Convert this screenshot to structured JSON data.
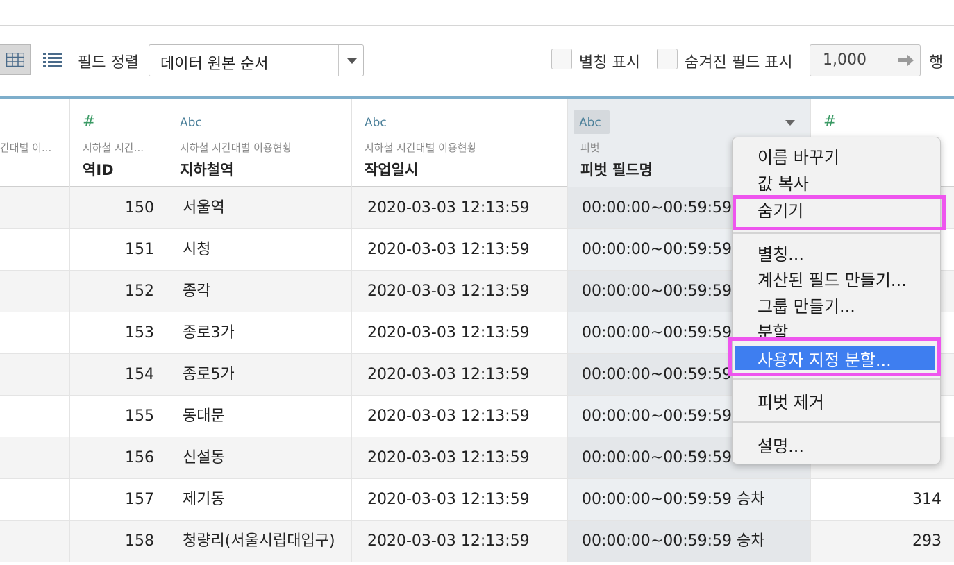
{
  "toolbar": {
    "sort_label": "필드 정렬",
    "sort_value": "데이터 원본 순서",
    "alias_label": "별칭 표시",
    "hidden_fields_label": "숨겨진 필드 표시",
    "row_count": "1,000",
    "rows_unit": "행"
  },
  "columns": [
    {
      "type": "",
      "source": "간대별 이...",
      "name": ""
    },
    {
      "type": "#",
      "source": "지하철 시간...",
      "name": "역ID"
    },
    {
      "type": "Abc",
      "source": "지하철 시간대별 이용현황",
      "name": "지하철역"
    },
    {
      "type": "Abc",
      "source": "지하철 시간대별 이용현황",
      "name": "작업일시"
    },
    {
      "type": "Abc",
      "source": "피벗",
      "name": "피벗 필드명"
    },
    {
      "type": "#",
      "source": "",
      "name": ""
    }
  ],
  "rows": [
    {
      "id": "150",
      "station": "서울역",
      "datetime": "2020-03-03 12:13:59",
      "pivot": "00:00:00~00:59:59",
      "value": ""
    },
    {
      "id": "151",
      "station": "시청",
      "datetime": "2020-03-03 12:13:59",
      "pivot": "00:00:00~00:59:59",
      "value": ""
    },
    {
      "id": "152",
      "station": "종각",
      "datetime": "2020-03-03 12:13:59",
      "pivot": "00:00:00~00:59:59",
      "value": ""
    },
    {
      "id": "153",
      "station": "종로3가",
      "datetime": "2020-03-03 12:13:59",
      "pivot": "00:00:00~00:59:59",
      "value": ""
    },
    {
      "id": "154",
      "station": "종로5가",
      "datetime": "2020-03-03 12:13:59",
      "pivot": "00:00:00~00:59:59",
      "value": ""
    },
    {
      "id": "155",
      "station": "동대문",
      "datetime": "2020-03-03 12:13:59",
      "pivot": "00:00:00~00:59:59",
      "value": ""
    },
    {
      "id": "156",
      "station": "신설동",
      "datetime": "2020-03-03 12:13:59",
      "pivot": "00:00:00~00:59:59",
      "value": ""
    },
    {
      "id": "157",
      "station": "제기동",
      "datetime": "2020-03-03 12:13:59",
      "pivot": "00:00:00~00:59:59 승차",
      "value": "314"
    },
    {
      "id": "158",
      "station": "청량리(서울시립대입구)",
      "datetime": "2020-03-03 12:13:59",
      "pivot": "00:00:00~00:59:59 승차",
      "value": "293"
    }
  ],
  "context_menu": {
    "items": [
      "이름 바꾸기",
      "값 복사",
      "숨기기",
      "별칭...",
      "계산된 필드 만들기...",
      "그룹 만들기...",
      "분할",
      "사용자 지정 분할...",
      "피벗 제거",
      "설명..."
    ],
    "active_item": "사용자 지정 분할..."
  },
  "highlight_color": "#ee55ee",
  "menu_active_color": "#3e7ef0",
  "header_accent_color": "#7eaecb",
  "icons": [
    "grid-view-icon",
    "list-view-icon",
    "dropdown-arrow-icon",
    "arrow-right-icon",
    "number-type-icon",
    "column-menu-arrow-icon"
  ]
}
